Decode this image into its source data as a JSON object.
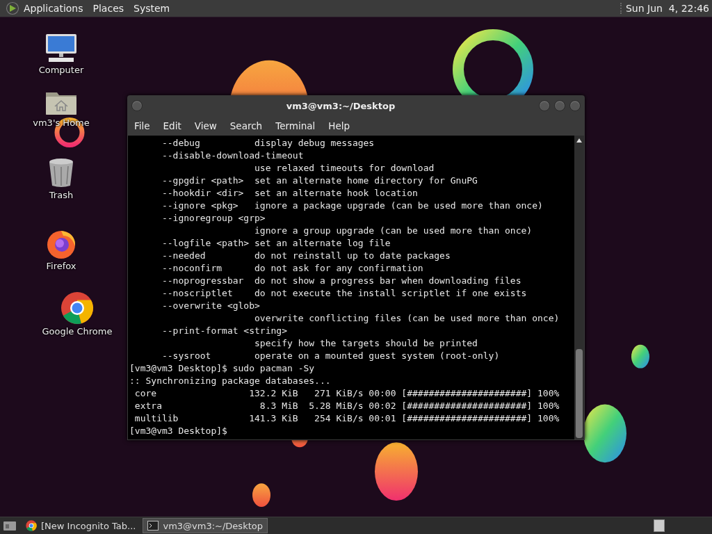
{
  "top_panel": {
    "menus": [
      "Applications",
      "Places",
      "System"
    ],
    "clock": "Sun Jun  4, 22:46"
  },
  "desktop_icons": [
    {
      "label": "Computer",
      "kind": "computer"
    },
    {
      "label": "vm3's Home",
      "kind": "home"
    },
    {
      "label": "Trash",
      "kind": "trash"
    },
    {
      "label": "Firefox",
      "kind": "firefox"
    },
    {
      "label": "Google Chrome",
      "kind": "chrome"
    }
  ],
  "terminal": {
    "title": "vm3@vm3:~/Desktop",
    "menus": [
      "File",
      "Edit",
      "View",
      "Search",
      "Terminal",
      "Help"
    ],
    "lines": [
      "      --debug          display debug messages",
      "      --disable-download-timeout",
      "                       use relaxed timeouts for download",
      "      --gpgdir <path>  set an alternate home directory for GnuPG",
      "      --hookdir <dir>  set an alternate hook location",
      "      --ignore <pkg>   ignore a package upgrade (can be used more than once)",
      "      --ignoregroup <grp>",
      "                       ignore a group upgrade (can be used more than once)",
      "      --logfile <path> set an alternate log file",
      "      --needed         do not reinstall up to date packages",
      "      --noconfirm      do not ask for any confirmation",
      "      --noprogressbar  do not show a progress bar when downloading files",
      "      --noscriptlet    do not execute the install scriptlet if one exists",
      "      --overwrite <glob>",
      "                       overwrite conflicting files (can be used more than once)",
      "      --print-format <string>",
      "                       specify how the targets should be printed",
      "      --sysroot        operate on a mounted guest system (root-only)",
      "[vm3@vm3 Desktop]$ sudo pacman -Sy",
      ":: Synchronizing package databases...",
      " core                 132.2 KiB   271 KiB/s 00:00 [######################] 100%",
      " extra                  8.3 MiB  5.28 MiB/s 00:02 [######################] 100%",
      " multilib             141.3 KiB   254 KiB/s 00:01 [######################] 100%",
      "[vm3@vm3 Desktop]$"
    ]
  },
  "taskbar": {
    "tasks": [
      {
        "label": "[New Incognito Tab...",
        "kind": "browser",
        "selected": false
      },
      {
        "label": "vm3@vm3:~/Desktop",
        "kind": "terminal",
        "selected": true
      }
    ]
  }
}
